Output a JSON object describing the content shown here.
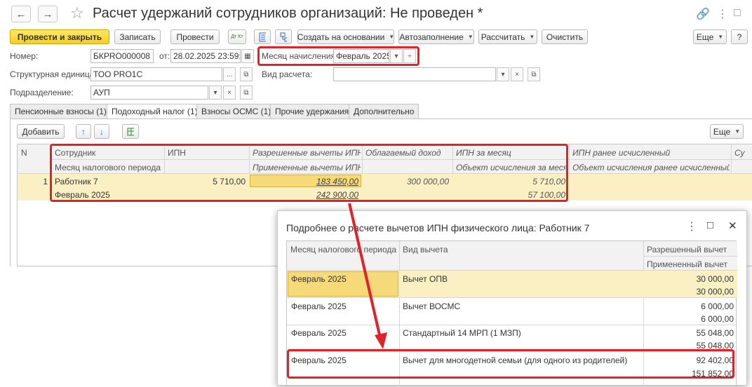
{
  "window": {
    "title": "Расчет удержаний сотрудников организаций: Не проведен *",
    "back_icon": "←",
    "forward_icon": "→",
    "star_icon": "☆",
    "link_icon": "🔗",
    "menu_icon": "⋮",
    "maximize_icon": "□",
    "close_icon": "✕"
  },
  "toolbar": {
    "post_close": "Провести и закрыть",
    "save": "Записать",
    "post": "Провести",
    "dtkt_icon": "Дт Кт",
    "create_based": "Создать на основании",
    "autofill": "Автозаполнение",
    "calculate": "Рассчитать",
    "clear": "Очистить",
    "more": "Еще",
    "help": "?"
  },
  "form": {
    "number_label": "Номер:",
    "number_value": "БКPRO000008",
    "date_label": "от:",
    "date_value": "28.02.2025 23:59:59",
    "month_label": "Месяц начисления:",
    "month_value": "Февраль 2025",
    "unit_label": "Структурная единица:",
    "unit_value": "ТОО PRO1C",
    "calc_type_label": "Вид расчета:",
    "calc_type_value": "",
    "dept_label": "Подразделение:",
    "dept_value": "АУП",
    "dots": "...",
    "x": "×",
    "open": "⧉",
    "calendar": "▦",
    "dropdown": "▾",
    "spin": "÷"
  },
  "tabs": [
    {
      "label": "Пенсионные взносы (1)"
    },
    {
      "label": "Подоходный налог (1)"
    },
    {
      "label": "Взносы ОСМС (1)"
    },
    {
      "label": "Прочие удержания"
    },
    {
      "label": "Дополнительно"
    }
  ],
  "table_toolbar": {
    "add": "Добавить",
    "up": "↑",
    "down": "↓",
    "more": "Еще"
  },
  "table": {
    "headers": {
      "n": "N",
      "employee": "Сотрудник",
      "tax_month": "Месяц налогового периода",
      "ipn": "ИПН",
      "allowed_deductions": "Разрешенные вычеты ИПН",
      "applied_deductions": "Примененные вычеты ИПН",
      "taxable_income": "Облагаемый доход",
      "ipn_month": "ИПН за месяц",
      "calc_object_month": "Объект исчисления за месяц",
      "ipn_earlier": "ИПН ранее исчисленный",
      "calc_object_earlier": "Объект исчисления ранее исчисленный",
      "su": "Су"
    },
    "rows": [
      {
        "n": "1",
        "employee": "Работник 7",
        "tax_month": "Февраль 2025",
        "ipn": "5 710,00",
        "allowed_deductions": "183 450,00",
        "applied_deductions": "242 900,00",
        "taxable_income": "300 000,00",
        "ipn_month": "5 710,00",
        "calc_object_month": "57 100,00"
      }
    ]
  },
  "popup": {
    "title": "Подробнее о расчете вычетов ИПН физического лица: Работник 7",
    "menu_icon": "⋮",
    "maximize_icon": "□",
    "close_icon": "✕",
    "headers": {
      "month": "Месяц налогового периода",
      "type": "Вид вычета",
      "allowed": "Разрешенный вычет",
      "applied": "Примененный вычет"
    },
    "rows": [
      {
        "month": "Февраль 2025",
        "type": "Вычет ОПВ",
        "allowed": "30 000,00",
        "applied": "30 000,00"
      },
      {
        "month": "Февраль 2025",
        "type": "Вычет ВОСМС",
        "allowed": "6 000,00",
        "applied": "6 000,00"
      },
      {
        "month": "Февраль 2025",
        "type": "Стандартный 14 МРП (1 МЗП)",
        "allowed": "55 048,00",
        "applied": "55 048,00"
      },
      {
        "month": "Февраль 2025",
        "type": "Вычет для многодетной семьи (для одного из родителей)",
        "allowed": "92 402,00",
        "applied": "151 852,00"
      }
    ]
  }
}
